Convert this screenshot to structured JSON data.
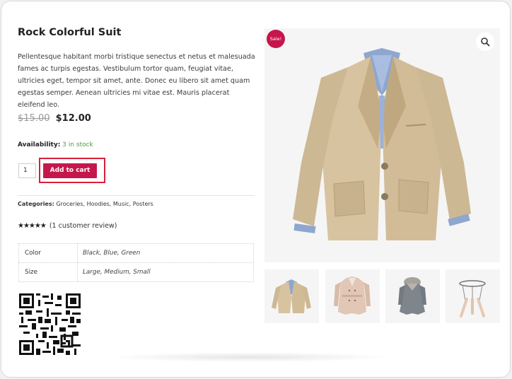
{
  "product": {
    "title": "Rock Colorful Suit",
    "description": "Pellentesque habitant morbi tristique senectus et netus et malesuada fames ac turpis egestas. Vestibulum tortor quam, feugiat vitae, ultricies eget, tempor sit amet, ante. Donec eu libero sit amet quam egestas semper. Aenean ultricies mi vitae est. Mauris placerat eleifend leo.",
    "old_price": "$15.00",
    "price": "$12.00",
    "availability_label": "Availability:",
    "availability_value": "3 in stock",
    "quantity": "1",
    "add_to_cart_label": "Add to cart",
    "categories_label": "Categories:",
    "categories": "Groceries, Hoodies, Music, Posters",
    "rating_text": "(1 customer review)",
    "rating_stars": 5,
    "sale_badge": "Sale!"
  },
  "attributes": [
    {
      "name": "Color",
      "value": "Black, Blue, Green"
    },
    {
      "name": "Size",
      "value": "Large, Medium, Small"
    }
  ],
  "gallery": {
    "thumbnails": [
      "blazer",
      "trench-coat",
      "fur-coat",
      "stool"
    ]
  },
  "colors": {
    "accent": "#c6174d",
    "stock": "#4f9a3a",
    "highlight_outline": "#d8203b"
  }
}
